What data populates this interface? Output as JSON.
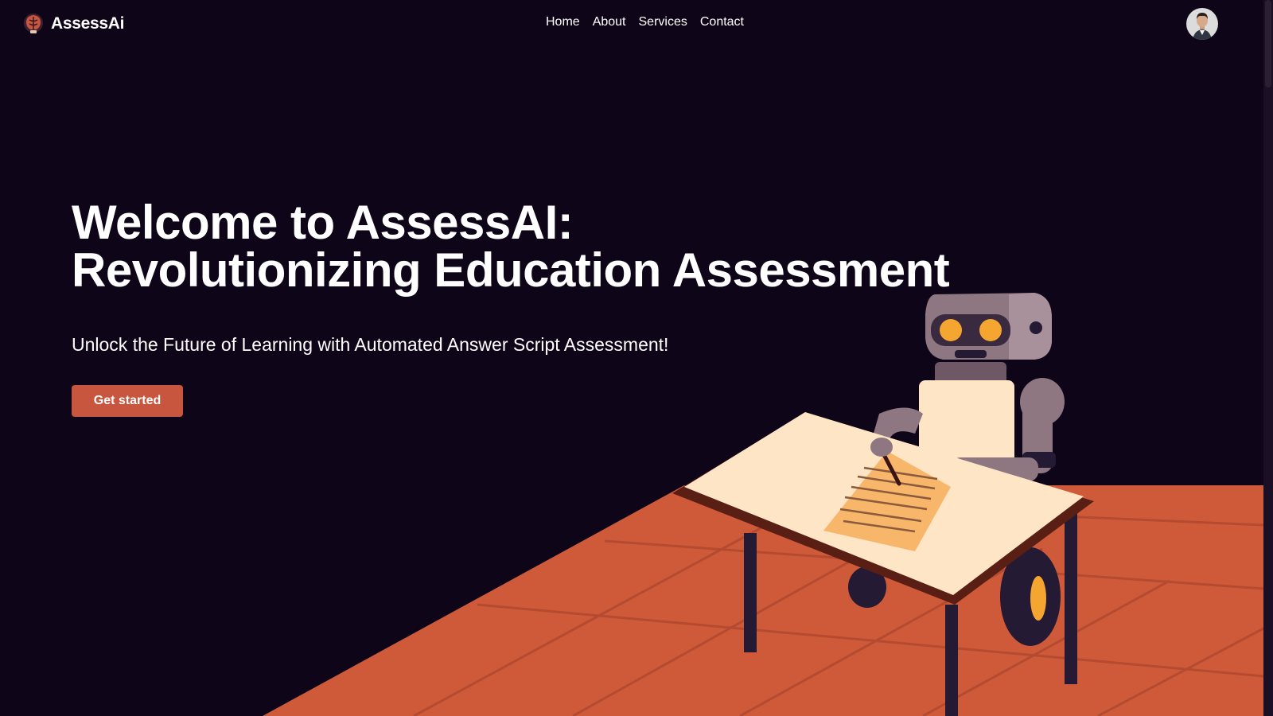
{
  "brand": {
    "name": "AssessAi",
    "logo_icon": "brain-lightbulb-icon"
  },
  "nav": {
    "items": [
      "Home",
      "About",
      "Services",
      "Contact"
    ]
  },
  "user": {
    "avatar_icon": "user-avatar"
  },
  "hero": {
    "title_line1": "Welcome to AssessAI:",
    "title_line2": "Revolutionizing Education Assessment",
    "subtitle": "Unlock the Future of Learning with Automated Answer Script Assessment!",
    "cta_label": "Get started",
    "illustration": "robot-grading-paper-at-desk"
  },
  "colors": {
    "background": "#0f0518",
    "accent": "#c8553d",
    "floor": "#cf5a3a",
    "text": "#ffffff"
  }
}
